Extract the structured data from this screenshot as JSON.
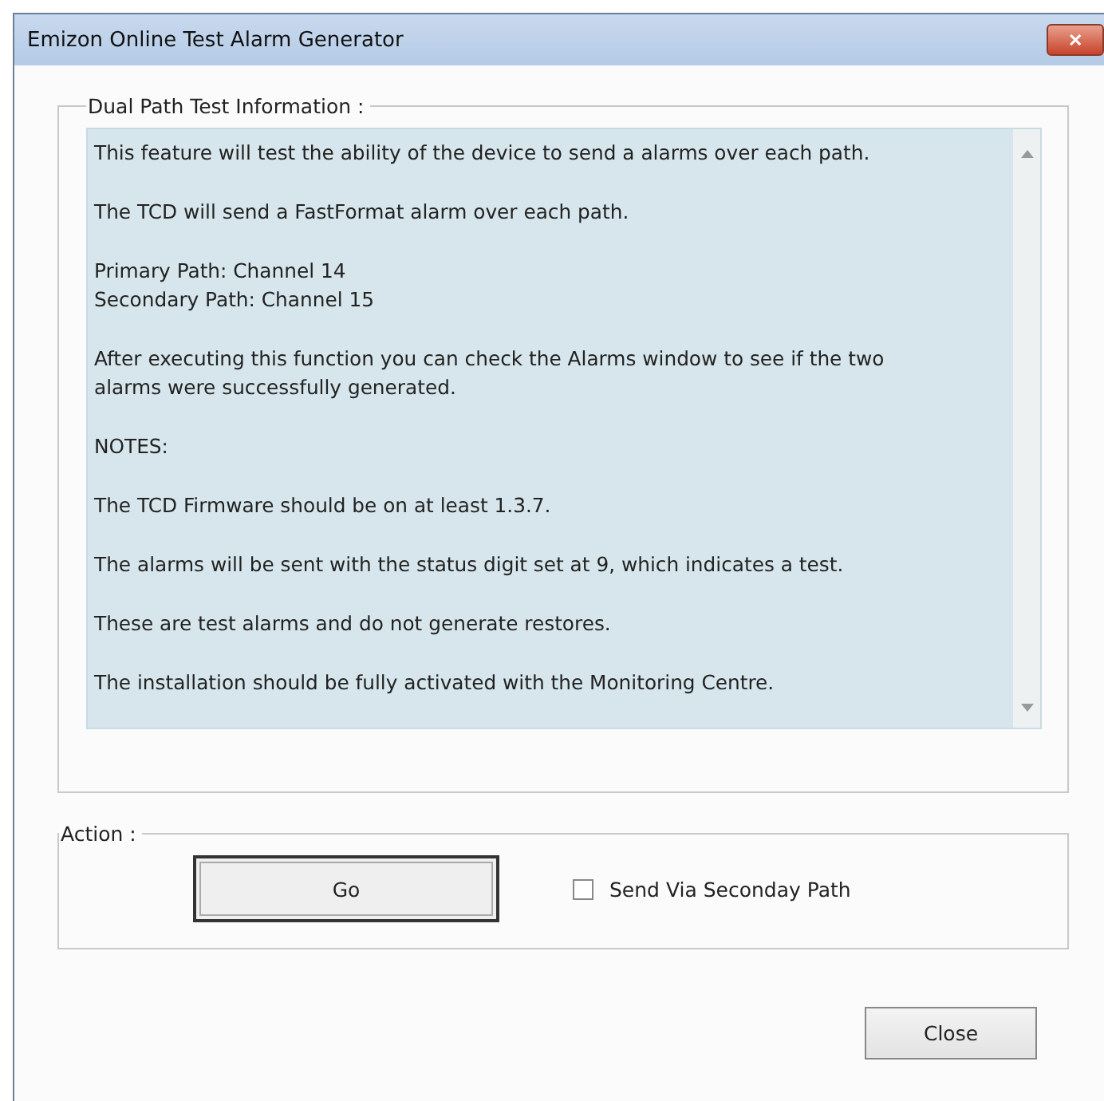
{
  "window": {
    "title": "Emizon Online Test Alarm Generator",
    "close_glyph": "✕"
  },
  "info_group": {
    "legend": "Dual Path Test Information :",
    "paragraphs": [
      [
        "This feature will test the ability of the device to send a alarms over each path."
      ],
      [
        "The TCD will send a FastFormat alarm over each path."
      ],
      [
        "Primary Path: Channel 14",
        "Secondary Path: Channel 15"
      ],
      [
        "After executing this function you can check the Alarms window to see if the two",
        "alarms were successfully generated."
      ],
      [
        "NOTES:"
      ],
      [
        "The TCD Firmware should be on at least 1.3.7."
      ],
      [
        "The alarms will be sent with the status digit set at 9, which indicates a test."
      ],
      [
        "These are test alarms and do not generate restores."
      ],
      [
        "The installation should be fully activated with the Monitoring Centre."
      ]
    ]
  },
  "action_group": {
    "legend": "Action :",
    "go_button": "Go",
    "checkbox": {
      "label": "Send Via Seconday Path",
      "checked": false
    }
  },
  "close_button": "Close"
}
